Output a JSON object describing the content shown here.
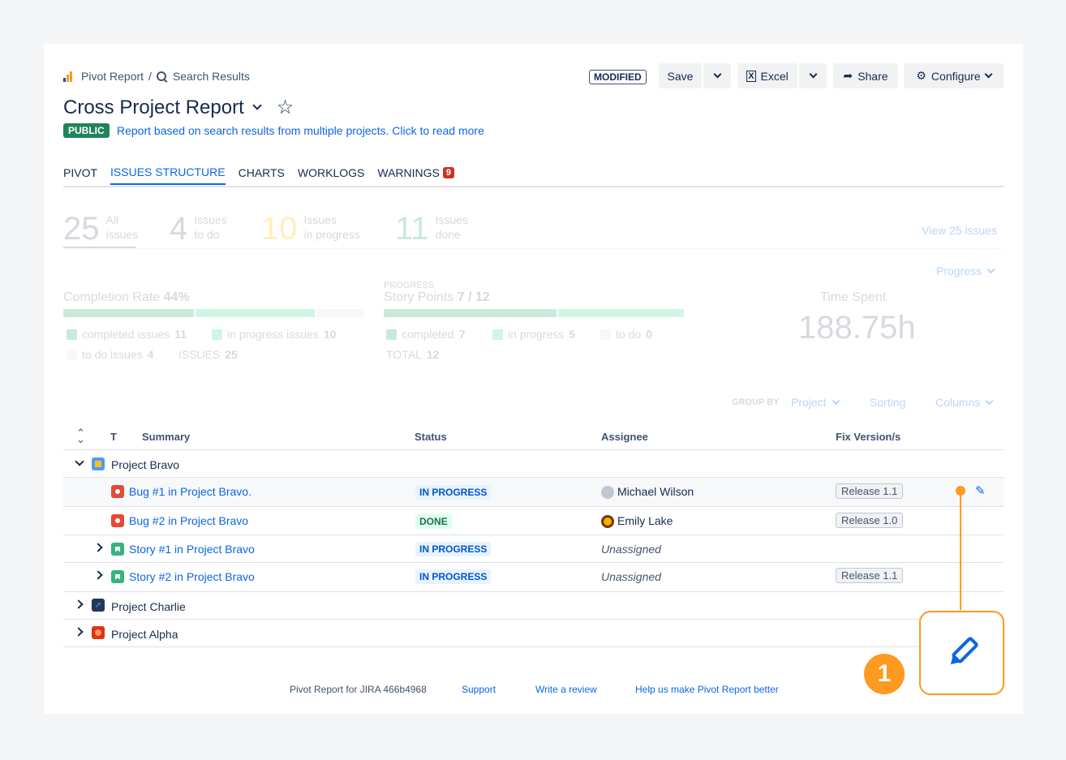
{
  "breadcrumb": {
    "root": "Pivot Report",
    "current": "Search Results"
  },
  "header": {
    "title": "Cross Project Report",
    "badge": "PUBLIC",
    "description": "Report based on search results from multiple projects. Click to read more",
    "modified": "MODIFIED"
  },
  "toolbar": {
    "save": "Save",
    "excel": "Excel",
    "share": "Share",
    "configure": "Configure"
  },
  "tabs": [
    {
      "label": "PIVOT"
    },
    {
      "label": "ISSUES STRUCTURE",
      "active": true
    },
    {
      "label": "CHARTS"
    },
    {
      "label": "WORKLOGS"
    },
    {
      "label": "WARNINGS",
      "badge": "9"
    }
  ],
  "stats": [
    {
      "num": "25",
      "line1": "All",
      "line2": "issues"
    },
    {
      "num": "4",
      "line1": "Issues",
      "line2": "to do"
    },
    {
      "num": "10",
      "line1": "Issues",
      "line2": "in progress"
    },
    {
      "num": "11",
      "line1": "Issues",
      "line2": "done"
    }
  ],
  "view_issues": "View 25 issues",
  "progress_dropdown": "Progress",
  "completion": {
    "title": "Completion Rate",
    "value": "44%",
    "legend": [
      {
        "label": "completed issues",
        "value": "11"
      },
      {
        "label": "in progress issues",
        "value": "10"
      },
      {
        "label": "to do issues",
        "value": "4"
      },
      {
        "label": "ISSUES",
        "value": "25"
      }
    ]
  },
  "story_points": {
    "caption": "PROGRESS",
    "title": "Story Points",
    "value": "7 / 12",
    "legend": [
      {
        "label": "completed",
        "value": "7"
      },
      {
        "label": "in progress",
        "value": "5"
      },
      {
        "label": "to do",
        "value": "0"
      },
      {
        "label": "TOTAL",
        "value": "12"
      }
    ]
  },
  "time_spent": {
    "title": "Time Spent",
    "value": "188.75h"
  },
  "group_controls": {
    "group_by": "GROUP BY",
    "project": "Project",
    "sorting": "Sorting",
    "columns": "Columns"
  },
  "table": {
    "headers": {
      "type": "T",
      "summary": "Summary",
      "status": "Status",
      "assignee": "Assignee",
      "fix_version": "Fix Version/s"
    },
    "projects": {
      "bravo": "Project Bravo",
      "charlie": "Project Charlie",
      "alpha": "Project Alpha"
    },
    "rows": [
      {
        "summary": "Bug #1 in Project Bravo.",
        "status": "IN PROGRESS",
        "assignee": "Michael Wilson",
        "version": "Release 1.1"
      },
      {
        "summary": "Bug #2 in Project Bravo",
        "status": "DONE",
        "assignee": "Emily Lake",
        "version": "Release 1.0"
      },
      {
        "summary": "Story #1 in Project Bravo",
        "status": "IN PROGRESS",
        "assignee": "Unassigned",
        "version": ""
      },
      {
        "summary": "Story #2 in Project Bravo",
        "status": "IN PROGRESS",
        "assignee": "Unassigned",
        "version": "Release 1.1"
      }
    ]
  },
  "footer": {
    "product": "Pivot Report for JIRA 466b4968",
    "support": "Support",
    "review": "Write a review",
    "help": "Help us make Pivot Report better"
  },
  "callout": {
    "number": "1"
  },
  "colors": {
    "accent": "#0c66e4",
    "callout": "#ff991f",
    "done": "#1f845a",
    "warning": "#ca3521"
  }
}
